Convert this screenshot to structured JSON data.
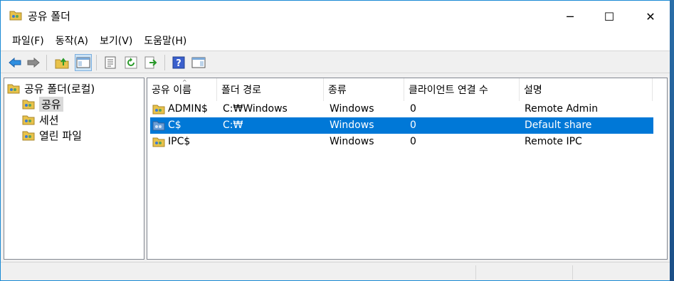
{
  "window": {
    "title": "공유 폴더",
    "icon": "shared-folder-icon",
    "controls": {
      "minimize": "─",
      "maximize": "☐",
      "close": "✕"
    }
  },
  "menu": [
    {
      "label": "파일(F)"
    },
    {
      "label": "동작(A)"
    },
    {
      "label": "보기(V)"
    },
    {
      "label": "도움말(H)"
    }
  ],
  "toolbar": {
    "buttons": [
      "back-arrow-icon",
      "forward-arrow-icon",
      "up-folder-icon",
      "show-hide-console-tree-icon",
      "properties-icon",
      "refresh-icon",
      "export-list-icon",
      "help-icon",
      "show-action-pane-icon"
    ]
  },
  "tree": {
    "root": "공유 폴더(로컬)",
    "items": [
      {
        "label": "공유",
        "selected": true
      },
      {
        "label": "세션",
        "selected": false
      },
      {
        "label": "열린 파일",
        "selected": false
      }
    ]
  },
  "list": {
    "columns": [
      "공유 이름",
      "폴더 경로",
      "종류",
      "클라이언트 연결 수",
      "설명"
    ],
    "sort_indicator": "^",
    "rows": [
      {
        "name": "ADMIN$",
        "path": "C:₩Windows",
        "type": "Windows",
        "clients": "0",
        "description": "Remote Admin",
        "selected": false
      },
      {
        "name": "C$",
        "path": "C:₩",
        "type": "Windows",
        "clients": "0",
        "description": "Default share",
        "selected": true
      },
      {
        "name": "IPC$",
        "path": "",
        "type": "Windows",
        "clients": "0",
        "description": "Remote IPC",
        "selected": false
      }
    ]
  },
  "colors": {
    "selection": "#0078d7",
    "folder": "#e8c24a",
    "accent_border": "#1a8ad4"
  }
}
